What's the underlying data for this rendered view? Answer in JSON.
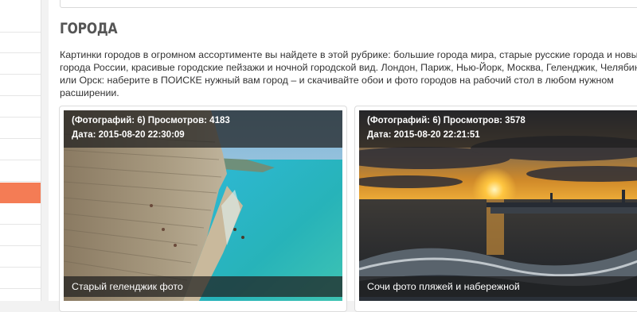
{
  "page": {
    "title": "ГОРОДА",
    "description": "Картинки городов в огромном ассортименте вы найдете в этой рубрике: большие города мира, старые русские города и новые города России, красивые городские пейзажи и ночной городской вид. Лондон, Париж, Нью-Йорк, Москва, Геленджик, Челябинск или Орск: наберите в ПОИСКЕ нужный вам город – и скачивайте обои и фото городов на рабочий стол в любом нужном расширении."
  },
  "cards": [
    {
      "meta_line_1": "(Фотографий: 6) Просмотров: 4183",
      "meta_line_2": "Дата: 2015-08-20 22:30:09",
      "caption": "Старый геленджик фото"
    },
    {
      "meta_line_1": "(Фотографий: 6) Просмотров: 3578",
      "meta_line_2": "Дата: 2015-08-20 22:21:51",
      "caption": "Сочи фото пляжей и набережной"
    }
  ],
  "colors": {
    "sidebar_active": "#f47c55",
    "overlay": "rgba(30,30,30,0.72)"
  }
}
